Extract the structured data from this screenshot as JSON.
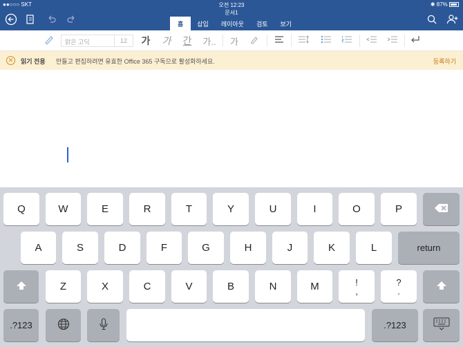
{
  "status_bar": {
    "carrier": "●●○○○ SKT",
    "time": "오전 12:23",
    "battery": "87%"
  },
  "document_title": "문서1",
  "header": {
    "tabs": [
      {
        "label": "홈",
        "active": true
      },
      {
        "label": "삽입",
        "active": false
      },
      {
        "label": "레이아웃",
        "active": false
      },
      {
        "label": "검토",
        "active": false
      },
      {
        "label": "보기",
        "active": false
      }
    ]
  },
  "ribbon": {
    "font_name": "맑은 고딕",
    "font_size": "12",
    "bold": "가",
    "italic": "가",
    "underline": "간",
    "more": "가..",
    "clear": "가"
  },
  "readonly_bar": {
    "title": "읽기 전용",
    "message": "만들고 편집하려면 유효한 Office 365 구독으로 활성화하세요.",
    "action": "등록하기"
  },
  "keyboard": {
    "row1": [
      "Q",
      "W",
      "E",
      "R",
      "T",
      "Y",
      "U",
      "I",
      "O",
      "P"
    ],
    "row2": [
      "A",
      "S",
      "D",
      "F",
      "G",
      "H",
      "J",
      "K",
      "L"
    ],
    "return": "return",
    "row3": [
      "Z",
      "X",
      "C",
      "V",
      "B",
      "N",
      "M"
    ],
    "punct1_top": "!",
    "punct1_bottom": ",",
    "punct2_top": "?",
    "punct2_bottom": ".",
    "numbers": ".?123"
  },
  "colors": {
    "header": "#2b5797",
    "readonly_bg": "#fcf0d2",
    "accent": "#c67a1a"
  }
}
